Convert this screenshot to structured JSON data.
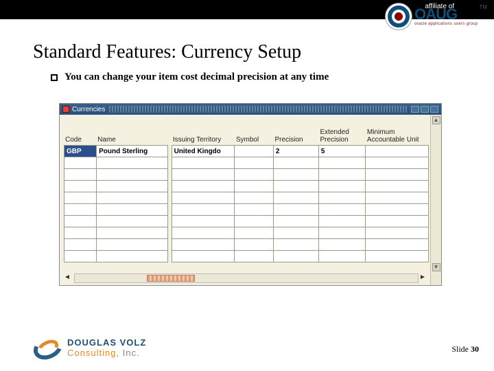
{
  "header": {
    "affiliate_label": "affiliate of",
    "oaug_name": "OAUG",
    "oaug_tagline": "oracle applications users group",
    "tm": "TM"
  },
  "title": "Standard Features:  Currency Setup",
  "bullet": "You can change your item cost decimal precision at any time",
  "form": {
    "window_title": "Currencies",
    "columns": {
      "code": "Code",
      "name": "Name",
      "description": "",
      "territory": "Issuing Territory",
      "symbol": "Symbol",
      "precision": "Precision",
      "ext_precision": "Extended Precision",
      "min_acct_unit": "Minimum Accountable Unit"
    },
    "rows": [
      {
        "code": "GBP",
        "name": "Pound Sterling",
        "territory": "United Kingdo",
        "symbol": "",
        "precision": "2",
        "ext_precision": "5",
        "min_acct_unit": ""
      }
    ],
    "blank_rows": 9
  },
  "footer": {
    "company_l1": "DOUGLAS VOLZ",
    "company_l2a": "Consulting,",
    "company_l2b": " Inc.",
    "slide_label": "Slide ",
    "slide_number": "30"
  }
}
